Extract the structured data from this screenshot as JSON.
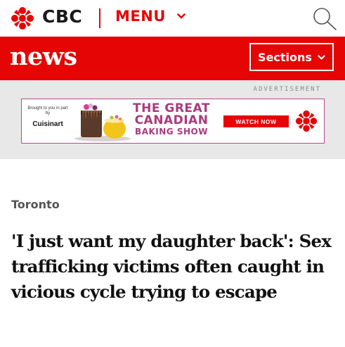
{
  "header": {
    "brand": "CBC",
    "menu_label": "MENU",
    "brand_color": "#e60505",
    "icons": [
      "cbc-gem-icon",
      "chevron-down-icon",
      "search-icon"
    ]
  },
  "newsbar": {
    "title": "news",
    "sections_label": "Sections",
    "background": "#e60505"
  },
  "ad": {
    "label": "ADVERTISEMENT",
    "brought_by": "Brought to you in part by",
    "sponsor": "Cuisinart",
    "show_line1": "THE GREAT",
    "show_line2": "CANADIAN",
    "show_line3": "BAKING SHOW",
    "cta": "WATCH NOW",
    "accent": "#a83a7e"
  },
  "article": {
    "section": "Toronto",
    "headline": "'I just want my daughter back': Sex trafficking victims often caught in vicious cycle trying to escape"
  }
}
